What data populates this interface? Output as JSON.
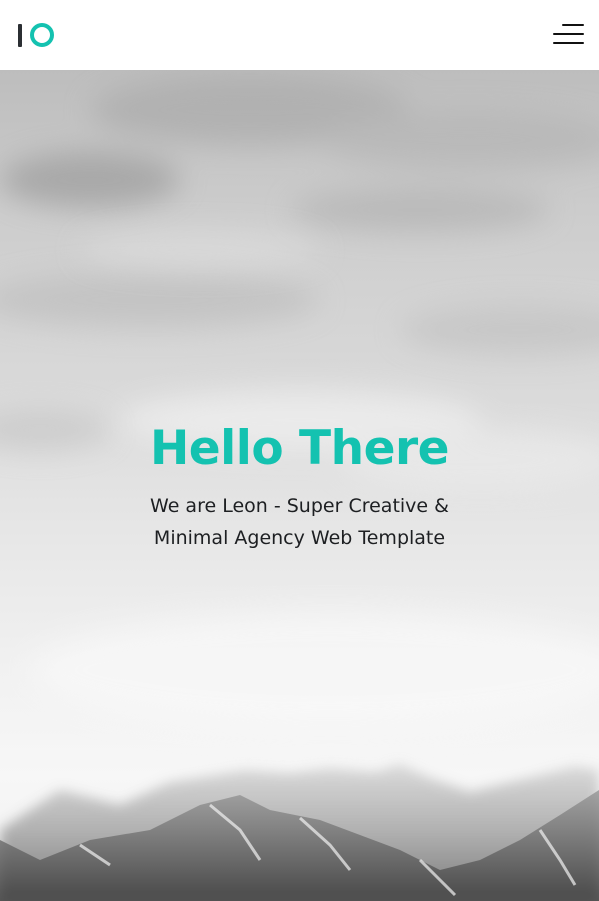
{
  "header": {
    "logo_alt": "IO",
    "menu_icon": "hamburger-menu-icon"
  },
  "hero": {
    "title": "Hello There",
    "subtitle_line1": "We are Leon - Super Creative &",
    "subtitle_line2": "Minimal Agency Web Template"
  },
  "colors": {
    "accent": "#14c2b0",
    "logo_dark": "#2b2f33",
    "text": "#1d1f22"
  }
}
